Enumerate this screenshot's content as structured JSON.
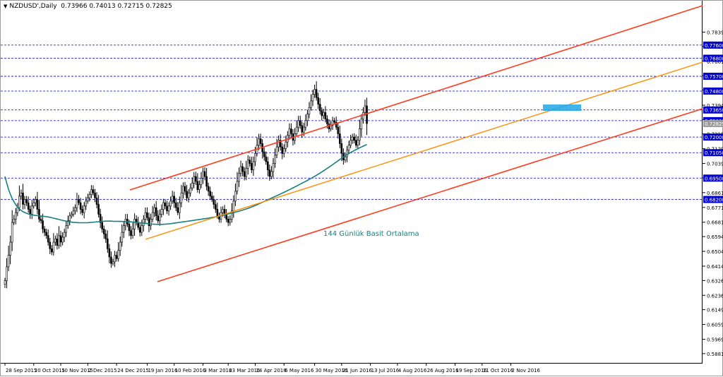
{
  "header": {
    "symbol": "NZDUSD',Daily",
    "ohlc": "0.73966 0.74013 0.72715 0.72825"
  },
  "chart_data": {
    "type": "candlestick",
    "ylim": [
      0.5825,
      0.797
    ],
    "y_ticks": [
      "0.78390",
      "0.77515",
      "0.76615",
      "0.75740",
      "0.74865",
      "0.73940",
      "0.73065",
      "0.72190",
      "0.71290",
      "0.70390",
      "0.69515",
      "0.68615",
      "0.67715",
      "0.66815",
      "0.65940",
      "0.65040",
      "0.64140",
      "0.63265",
      "0.62365",
      "0.61490",
      "0.60590",
      "0.59690",
      "0.58815"
    ],
    "x_tick_labels": [
      "28 Sep 2015",
      "20 Oct 2015",
      "10 Nov 2015",
      "2 Dec 2015",
      "24 Dec 2015",
      "19 Jan 2016",
      "10 Feb 2016",
      "3 Mar 2016",
      "23 Mar 2016",
      "14 Apr 2016",
      "6 May 2016",
      "30 May 2016",
      "21 Jun 2016",
      "13 Jul 2016",
      "4 Aug 2016",
      "26 Aug 2016",
      "19 Sep 2016",
      "11 Oct 2016",
      "2 Nov 2016"
    ],
    "x_tick_bars": [
      0,
      16,
      31,
      46,
      62,
      79,
      94,
      110,
      124,
      139,
      155,
      172,
      187,
      203,
      218,
      234,
      250,
      265,
      281
    ],
    "horizontal_levels": [
      {
        "label": "0.77600",
        "value": 0.776
      },
      {
        "label": "0.76800",
        "value": 0.768
      },
      {
        "label": "0.75700",
        "value": 0.757
      },
      {
        "label": "0.74800",
        "value": 0.748
      },
      {
        "label": "0.73650",
        "value": 0.7365
      },
      {
        "label": "0.73000",
        "value": 0.73
      },
      {
        "label": "0.72000",
        "value": 0.72
      },
      {
        "label": "0.71050",
        "value": 0.7105
      },
      {
        "label": "0.69500",
        "value": 0.695
      },
      {
        "label": "0.68200",
        "value": 0.682
      }
    ],
    "price_marker": {
      "label": "0.72825",
      "value": 0.72825,
      "color": "#9a9a9a"
    },
    "level_color": "#0000cc",
    "candle_color": "#000000",
    "closes": [
      0.6325,
      0.641,
      0.648,
      0.656,
      0.668,
      0.67,
      0.674,
      0.677,
      0.684,
      0.686,
      0.679,
      0.682,
      0.68,
      0.676,
      0.673,
      0.678,
      0.68,
      0.682,
      0.676,
      0.67,
      0.669,
      0.664,
      0.662,
      0.66,
      0.656,
      0.652,
      0.65,
      0.656,
      0.658,
      0.654,
      0.66,
      0.656,
      0.659,
      0.662,
      0.666,
      0.669,
      0.672,
      0.673,
      0.675,
      0.677,
      0.682,
      0.68,
      0.676,
      0.674,
      0.678,
      0.681,
      0.683,
      0.685,
      0.688,
      0.686,
      0.683,
      0.679,
      0.673,
      0.668,
      0.664,
      0.661,
      0.658,
      0.652,
      0.647,
      0.643,
      0.644,
      0.648,
      0.646,
      0.651,
      0.656,
      0.662,
      0.666,
      0.67,
      0.667,
      0.663,
      0.66,
      0.664,
      0.67,
      0.668,
      0.665,
      0.662,
      0.666,
      0.67,
      0.674,
      0.671,
      0.666,
      0.67,
      0.674,
      0.677,
      0.672,
      0.669,
      0.673,
      0.676,
      0.68,
      0.678,
      0.675,
      0.678,
      0.681,
      0.684,
      0.68,
      0.677,
      0.674,
      0.68,
      0.686,
      0.69,
      0.687,
      0.683,
      0.686,
      0.689,
      0.692,
      0.696,
      0.693,
      0.688,
      0.691,
      0.695,
      0.699,
      0.696,
      0.69,
      0.687,
      0.684,
      0.682,
      0.679,
      0.676,
      0.672,
      0.67,
      0.674,
      0.676,
      0.673,
      0.67,
      0.668,
      0.67,
      0.675,
      0.681,
      0.687,
      0.693,
      0.698,
      0.702,
      0.699,
      0.696,
      0.701,
      0.706,
      0.704,
      0.7,
      0.705,
      0.71,
      0.715,
      0.719,
      0.716,
      0.711,
      0.708,
      0.705,
      0.7,
      0.696,
      0.699,
      0.704,
      0.709,
      0.714,
      0.718,
      0.714,
      0.71,
      0.713,
      0.717,
      0.721,
      0.725,
      0.722,
      0.718,
      0.722,
      0.726,
      0.73,
      0.727,
      0.723,
      0.726,
      0.73,
      0.734,
      0.738,
      0.742,
      0.746,
      0.749,
      0.744,
      0.74,
      0.736,
      0.733,
      0.735,
      0.731,
      0.728,
      0.725,
      0.727,
      0.73,
      0.729,
      0.726,
      0.722,
      0.716,
      0.71,
      0.706,
      0.708,
      0.712,
      0.715,
      0.718,
      0.72,
      0.718,
      0.715,
      0.718,
      0.725,
      0.731,
      0.735,
      0.739,
      0.7282
    ]
  },
  "annotation": {
    "sma_label": "144 Günlük Basit Ortalama"
  },
  "colors": {
    "channel_upper": "#ff3c1e",
    "channel_middle": "#ff8c00",
    "channel_lower": "#ff3c1e",
    "sma": "#138080",
    "level_tag_bg": "#0000cc",
    "highlight_box": "#20a8e8"
  }
}
